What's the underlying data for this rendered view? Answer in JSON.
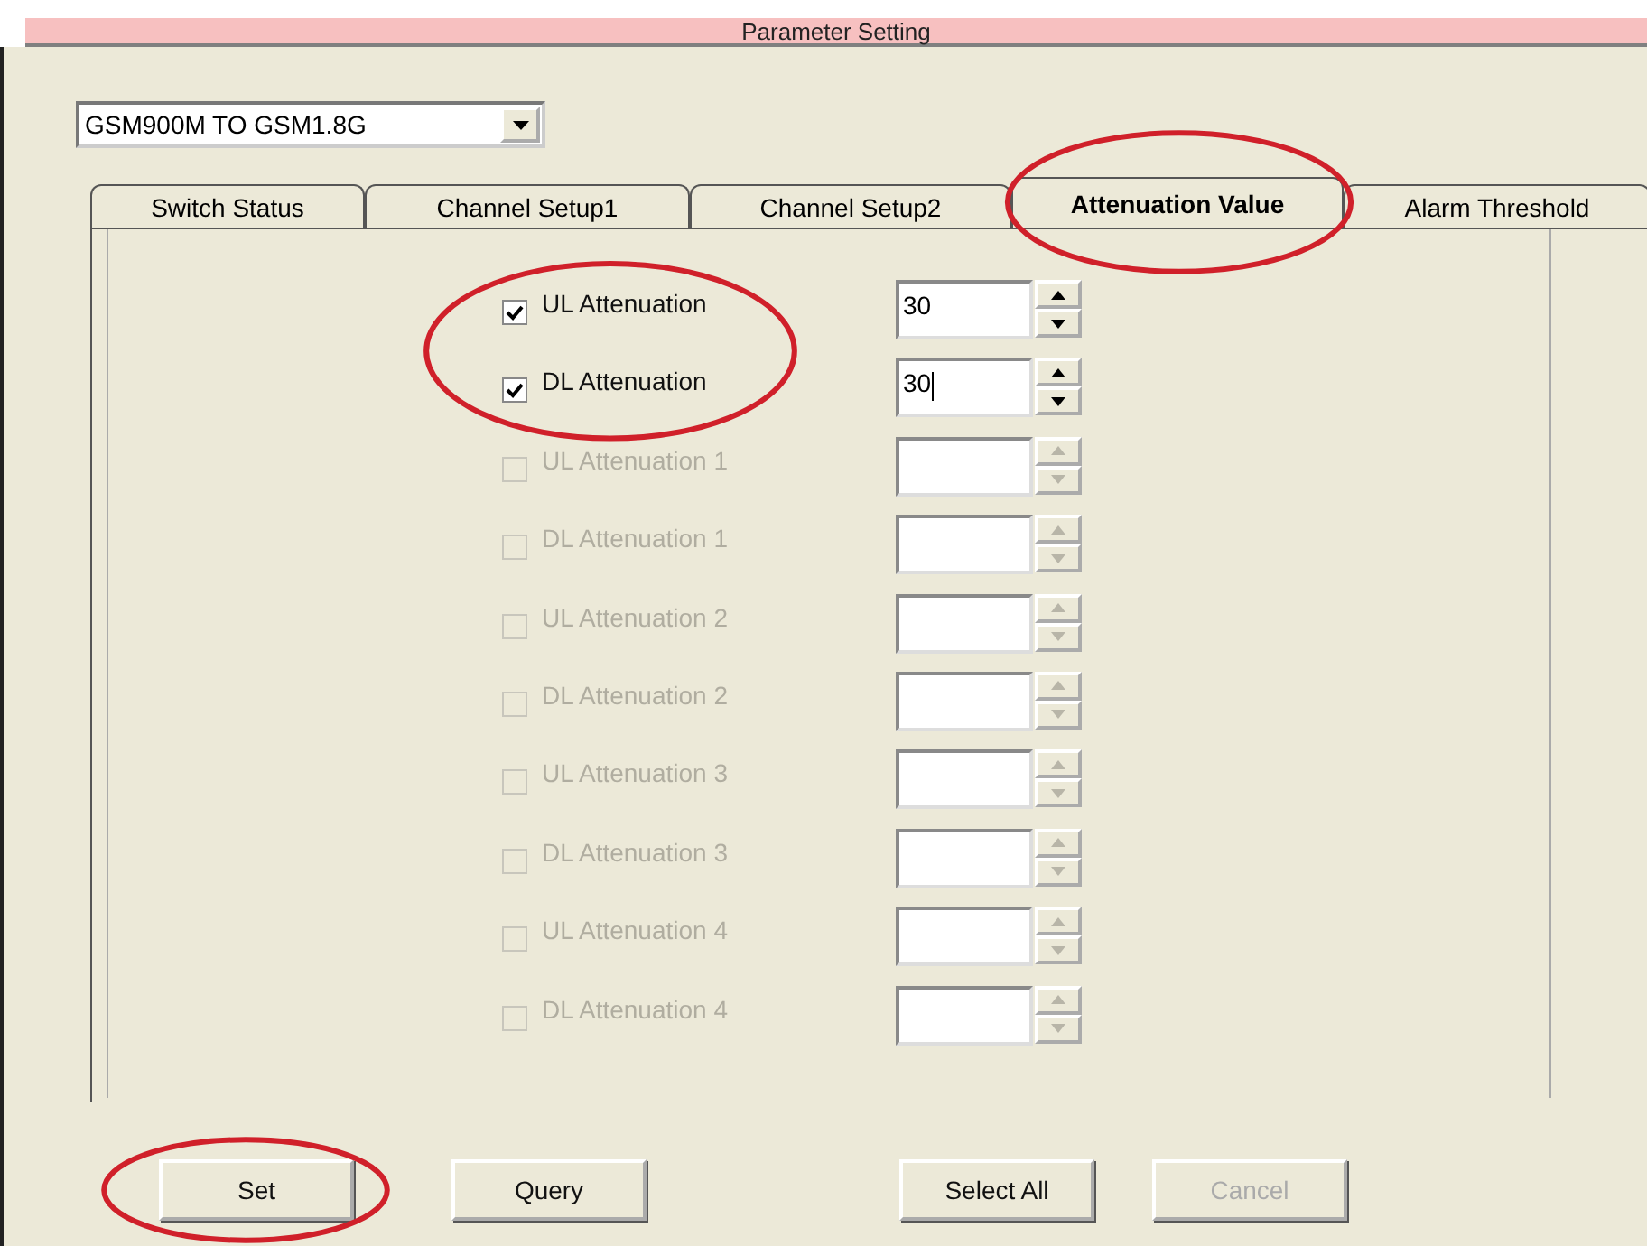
{
  "window": {
    "title": "Parameter Setting"
  },
  "mode_select": {
    "value": "GSM900M TO GSM1.8G"
  },
  "tabs": [
    {
      "label": "Switch Status",
      "selected": false,
      "circled": false
    },
    {
      "label": "Channel Setup1",
      "selected": false,
      "circled": false
    },
    {
      "label": "Channel Setup2",
      "selected": false,
      "circled": false
    },
    {
      "label": "Attenuation Value",
      "selected": true,
      "circled": true
    },
    {
      "label": "Alarm Threshold",
      "selected": false,
      "circled": false
    }
  ],
  "rows": [
    {
      "label": "UL Attenuation",
      "checked": true,
      "disabled": false,
      "value": "30",
      "focused": false,
      "circled": true
    },
    {
      "label": "DL Attenuation",
      "checked": true,
      "disabled": false,
      "value": "30",
      "focused": true,
      "circled": true
    },
    {
      "label": "UL Attenuation 1",
      "checked": false,
      "disabled": true,
      "circled": false
    },
    {
      "label": "DL Attenuation 1",
      "checked": false,
      "disabled": true,
      "circled": false
    },
    {
      "label": "UL Attenuation 2",
      "checked": false,
      "disabled": true,
      "circled": false
    },
    {
      "label": "DL Attenuation 2",
      "checked": false,
      "disabled": true,
      "circled": false
    },
    {
      "label": "UL Attenuation 3",
      "checked": false,
      "disabled": true,
      "circled": false
    },
    {
      "label": "DL Attenuation 3",
      "checked": false,
      "disabled": true,
      "circled": false
    },
    {
      "label": "UL Attenuation 4",
      "checked": false,
      "disabled": true,
      "circled": false
    },
    {
      "label": "DL Attenuation 4",
      "checked": false,
      "disabled": true,
      "circled": false
    }
  ],
  "buttons": [
    {
      "label": "Set",
      "disabled": false,
      "circled": true
    },
    {
      "label": "Query",
      "disabled": false,
      "circled": false
    },
    {
      "label": "Select All",
      "disabled": false,
      "circled": false
    },
    {
      "label": "Cancel",
      "disabled": true,
      "circled": false
    }
  ]
}
